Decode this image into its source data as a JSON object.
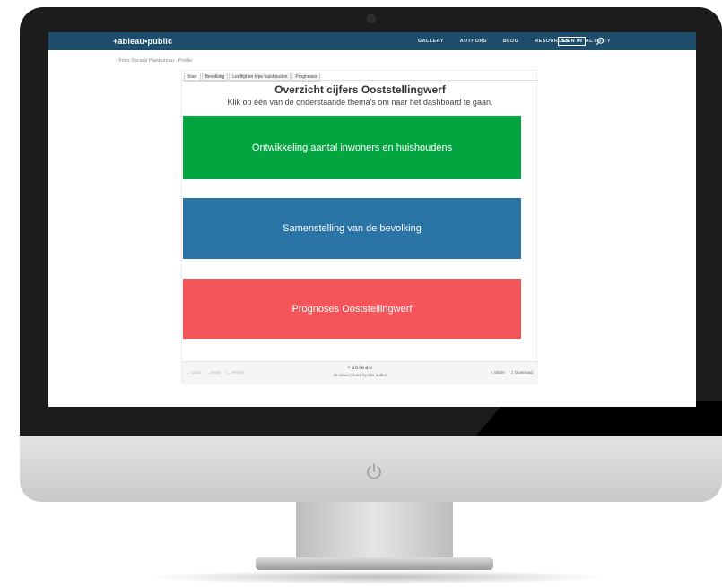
{
  "colors": {
    "nav_bg": "#1e4d6b",
    "block_green": "#03a541",
    "block_blue": "#2b74a6",
    "block_red": "#f4555a"
  },
  "topnav": {
    "logo": "+ableau•public",
    "links": [
      "GALLERY",
      "AUTHORS",
      "BLOG",
      "RESOURCES",
      "ACTIVITY"
    ],
    "signin": "SIGN IN"
  },
  "profile": {
    "back_link": "‹ Fries Sociaal Planbureau - Profile"
  },
  "viz": {
    "tabs": [
      "Start",
      "Bevolking",
      "Leeftijd en type huishouden",
      "Prognoses"
    ],
    "title": "Overzicht cijfers Ooststellingwerf",
    "subtitle": "Klik op één van de onderstaande thema's om naar het dashboard te gaan.",
    "blocks": [
      "Ontwikkeling aantal inwoners en huishoudens",
      "Samenstelling van de bevolking",
      "Prognoses Ooststellingwerf"
    ]
  },
  "toolbar": {
    "undo": "← Undo",
    "redo": "→ Redo",
    "revert": "|← Revert",
    "brand": "+ableau",
    "views": "29 views | more by this author",
    "share": "Share",
    "download": "Download"
  }
}
